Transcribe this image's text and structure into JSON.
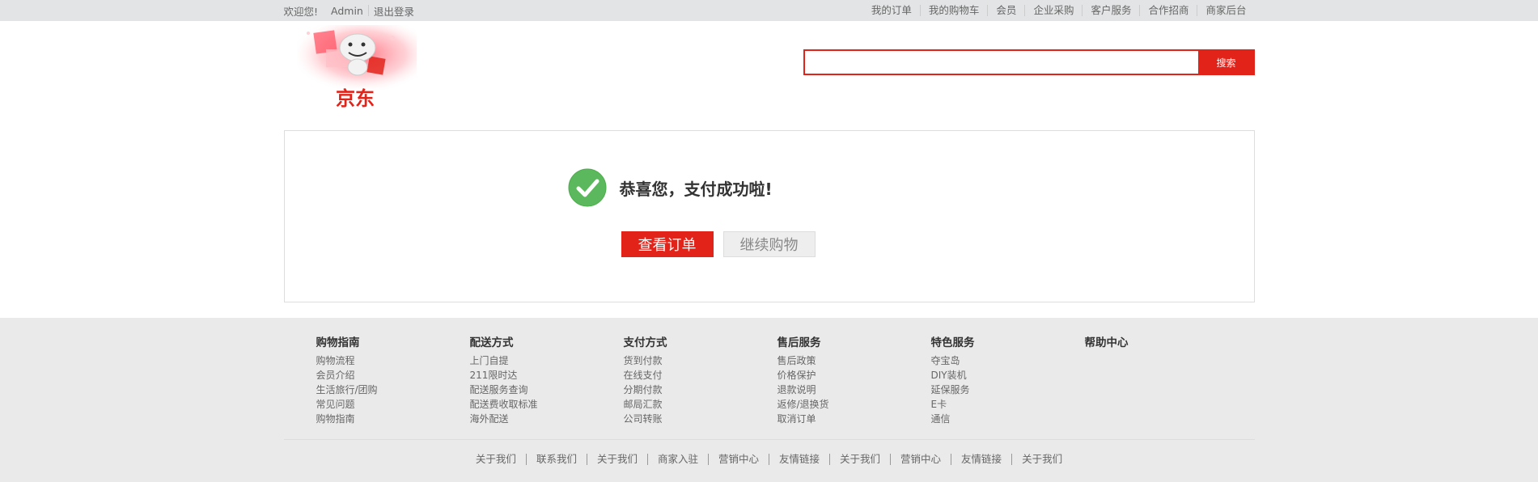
{
  "topbar": {
    "welcome": "欢迎您!",
    "user": "Admin",
    "logout": "退出登录",
    "links": [
      "我的订单",
      "我的购物车",
      "会员",
      "企业采购",
      "客户服务",
      "合作招商",
      "商家后台"
    ]
  },
  "header": {
    "logo_text": "京东",
    "search": {
      "value": "",
      "placeholder": "",
      "button_label": "搜索"
    }
  },
  "success": {
    "message": "恭喜您，支付成功啦!",
    "view_order_label": "查看订单",
    "continue_shopping_label": "继续购物"
  },
  "footer": {
    "columns": [
      {
        "title": "购物指南",
        "items": [
          "购物流程",
          "会员介绍",
          "生活旅行/团购",
          "常见问题",
          "购物指南"
        ]
      },
      {
        "title": "配送方式",
        "items": [
          "上门自提",
          "211限时达",
          "配送服务查询",
          "配送费收取标准",
          "海外配送"
        ]
      },
      {
        "title": "支付方式",
        "items": [
          "货到付款",
          "在线支付",
          "分期付款",
          "邮局汇款",
          "公司转账"
        ]
      },
      {
        "title": "售后服务",
        "items": [
          "售后政策",
          "价格保护",
          "退款说明",
          "返修/退换货",
          "取消订单"
        ]
      },
      {
        "title": "特色服务",
        "items": [
          "夺宝岛",
          "DIY装机",
          "延保服务",
          "E卡",
          "通信"
        ]
      },
      {
        "title": "帮助中心",
        "items": []
      }
    ],
    "links": [
      "关于我们",
      "联系我们",
      "关于我们",
      "商家入驻",
      "营销中心",
      "友情链接",
      "关于我们",
      "营销中心",
      "友情链接",
      "关于我们"
    ]
  },
  "colors": {
    "accent": "#e2231a",
    "success": "#5cb85c",
    "topbar_bg": "#e3e4e5",
    "footer_bg": "#eaeaea"
  },
  "icons": {
    "success": "check-circle-icon"
  }
}
